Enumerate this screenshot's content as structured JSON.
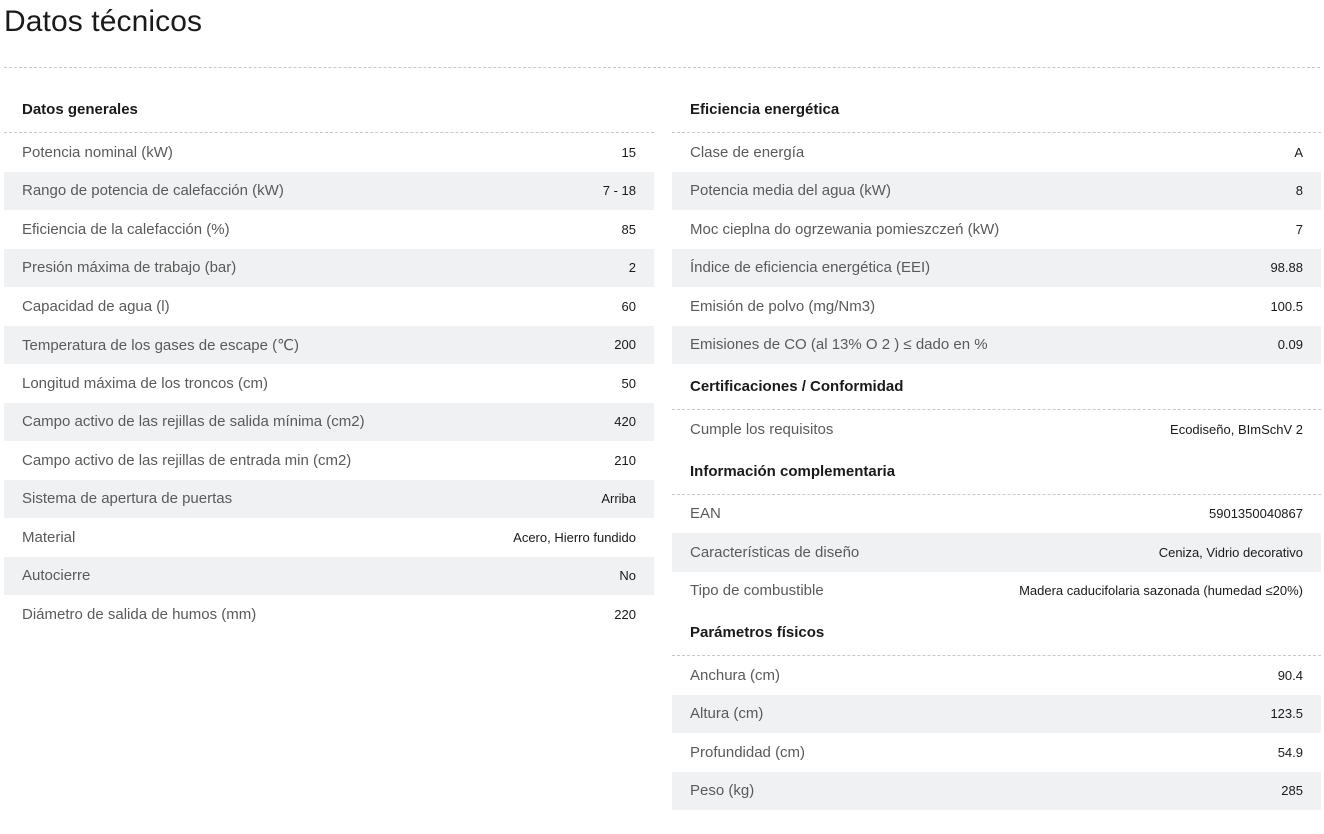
{
  "page": {
    "title": "Datos técnicos"
  },
  "left_column": {
    "sections": [
      {
        "heading": "Datos generales",
        "rows": [
          {
            "label": "Potencia nominal (kW)",
            "value": "15"
          },
          {
            "label": "Rango de potencia de calefacción (kW)",
            "value": "7 - 18"
          },
          {
            "label": "Eficiencia de la calefacción (%)",
            "value": "85"
          },
          {
            "label": "Presión máxima de trabajo (bar)",
            "value": "2"
          },
          {
            "label": "Capacidad de agua (l)",
            "value": "60"
          },
          {
            "label": "Temperatura de los gases de escape (℃)",
            "value": "200"
          },
          {
            "label": "Longitud máxima de los troncos (cm)",
            "value": "50"
          },
          {
            "label": "Campo activo de las rejillas de salida mínima (cm2)",
            "value": "420"
          },
          {
            "label": "Campo activo de las rejillas de entrada min (cm2)",
            "value": "210"
          },
          {
            "label": "Sistema de apertura de puertas",
            "value": "Arriba"
          },
          {
            "label": "Material",
            "value": "Acero, Hierro fundido"
          },
          {
            "label": "Autocierre",
            "value": "No"
          },
          {
            "label": "Diámetro de salida de humos (mm)",
            "value": "220"
          }
        ]
      }
    ]
  },
  "right_column": {
    "sections": [
      {
        "heading": "Eficiencia energética",
        "rows": [
          {
            "label": "Clase de energía",
            "value": "A"
          },
          {
            "label": "Potencia media del agua (kW)",
            "value": "8"
          },
          {
            "label": "Moc cieplna do ogrzewania pomieszczeń (kW)",
            "value": "7"
          },
          {
            "label": "Índice de eficiencia energética (EEI)",
            "value": "98.88"
          },
          {
            "label": "Emisión de polvo (mg/Nm3)",
            "value": "100.5"
          },
          {
            "label": "Emisiones de CO (al 13% O 2 ) ≤ dado en %",
            "value": "0.09"
          }
        ]
      },
      {
        "heading": "Certificaciones / Conformidad",
        "rows": [
          {
            "label": "Cumple los requisitos",
            "value": "Ecodiseño, BImSchV 2"
          }
        ]
      },
      {
        "heading": "Información complementaria",
        "rows": [
          {
            "label": "EAN",
            "value": "5901350040867"
          },
          {
            "label": "Características de diseño",
            "value": "Ceniza, Vidrio decorativo"
          },
          {
            "label": "Tipo de combustible",
            "value": "Madera caducifolaria sazonada (humedad ≤20%)"
          }
        ]
      },
      {
        "heading": "Parámetros físicos",
        "rows": [
          {
            "label": "Anchura (cm)",
            "value": "90.4"
          },
          {
            "label": "Altura (cm)",
            "value": "123.5"
          },
          {
            "label": "Profundidad (cm)",
            "value": "54.9"
          },
          {
            "label": "Peso (kg)",
            "value": "285"
          }
        ]
      }
    ]
  },
  "colors": {
    "row_stripe": "#f0f1f3",
    "label_text": "#5a5a5a",
    "value_text": "#1a1a1a",
    "divider": "#c8c8c8"
  }
}
